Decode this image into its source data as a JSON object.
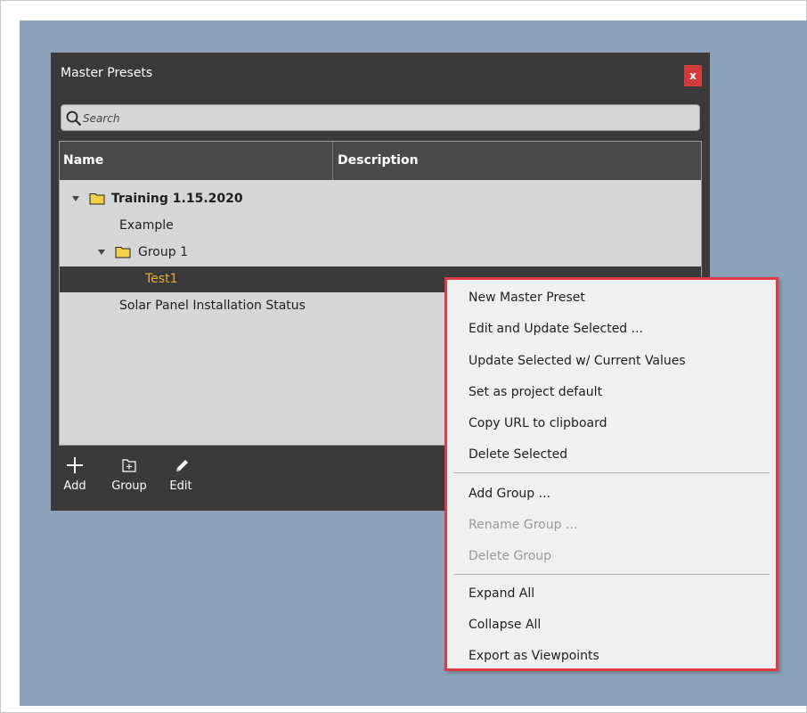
{
  "window": {
    "title": "Master Presets",
    "close_label": "x"
  },
  "search": {
    "placeholder": "Search",
    "value": ""
  },
  "columns": {
    "name": "Name",
    "description": "Description"
  },
  "tree": {
    "items": [
      {
        "label": "Training 1.15.2020",
        "type": "folder",
        "expanded": true
      },
      {
        "label": "Example",
        "type": "preset"
      },
      {
        "label": "Group 1",
        "type": "folder",
        "expanded": true
      },
      {
        "label": "Test1",
        "type": "preset",
        "selected": true
      },
      {
        "label": "Solar Panel Installation Status",
        "type": "preset"
      }
    ]
  },
  "toolbar": {
    "add_label": "Add",
    "group_label": "Group",
    "edit_label": "Edit"
  },
  "context_menu": {
    "items": [
      {
        "label": "New Master Preset",
        "enabled": true
      },
      {
        "label": "Edit and Update Selected ...",
        "enabled": true
      },
      {
        "label": "Update Selected w/ Current Values",
        "enabled": true
      },
      {
        "label": "Set as project default",
        "enabled": true
      },
      {
        "label": "Copy URL to clipboard",
        "enabled": true
      },
      {
        "label": "Delete Selected",
        "enabled": true
      },
      {
        "label": "Add Group ...",
        "enabled": true
      },
      {
        "label": "Rename Group ...",
        "enabled": false
      },
      {
        "label": "Delete Group",
        "enabled": false
      },
      {
        "label": "Expand All",
        "enabled": true
      },
      {
        "label": "Collapse All",
        "enabled": true
      },
      {
        "label": "Export as Viewpoints",
        "enabled": true
      }
    ]
  },
  "colors": {
    "panel_bg": "#3a3a3a",
    "selected_text": "#f0a830",
    "close_button": "#d23b3b",
    "highlight_border": "#e03a44",
    "folder": "#f5d04a"
  }
}
